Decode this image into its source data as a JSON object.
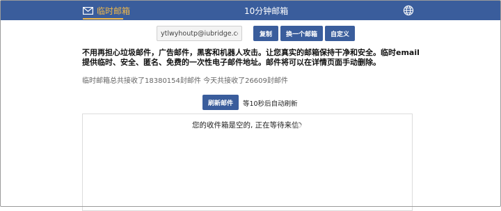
{
  "nav": {
    "temp_mail_label": "临时邮箱",
    "ten_min_label": "10分钟邮箱",
    "icons": {
      "mail": "envelope-icon",
      "language": "globe-icon"
    }
  },
  "email_bar": {
    "address": "ytlwyhoutp@iubridge.com",
    "copy_label": "复制",
    "change_label": "换一个邮箱",
    "custom_label": "自定义"
  },
  "notice": "不用再担心垃圾邮件，广告邮件，黑客和机器人攻击。让您真实的邮箱保持干净和安全。临时email提供临时、安全、匿名、免费的一次性电子邮件地址。邮件将可以在详情页面手动删除。",
  "stats": "临时邮箱总共接收了18380154封邮件 今天共接收了26609封邮件",
  "refresh": {
    "button_label": "刷新邮件",
    "hint": "等10秒后自动刷新"
  },
  "inbox": {
    "empty_message": "您的收件箱是空的, 正在等待来信"
  },
  "colors": {
    "nav_bg": "#3a5d9c",
    "accent": "#f0b84a",
    "button_bg": "#3a5d9c"
  }
}
